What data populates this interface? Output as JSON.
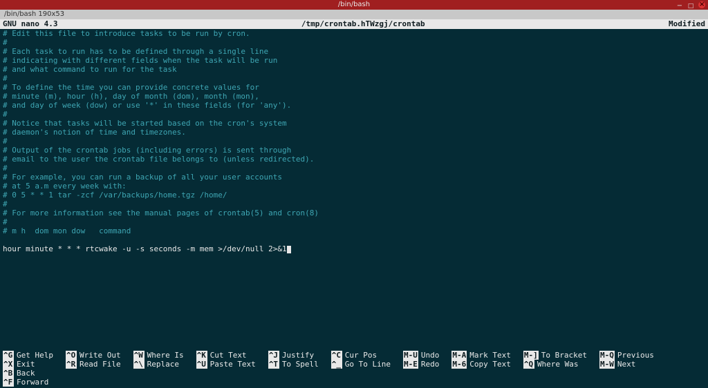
{
  "window": {
    "title": "/bin/bash"
  },
  "terminal_tab": "/bin/bash 190x53",
  "nano": {
    "version": "GNU nano 4.3",
    "file_path": "/tmp/crontab.hTWzgj/crontab",
    "status": "Modified"
  },
  "editor_lines": [
    "# Edit this file to introduce tasks to be run by cron.",
    "#",
    "# Each task to run has to be defined through a single line",
    "# indicating with different fields when the task will be run",
    "# and what command to run for the task",
    "#",
    "# To define the time you can provide concrete values for",
    "# minute (m), hour (h), day of month (dom), month (mon),",
    "# and day of week (dow) or use '*' in these fields (for 'any').",
    "#",
    "# Notice that tasks will be started based on the cron's system",
    "# daemon's notion of time and timezones.",
    "#",
    "# Output of the crontab jobs (including errors) is sent through",
    "# email to the user the crontab file belongs to (unless redirected).",
    "#",
    "# For example, you can run a backup of all your user accounts",
    "# at 5 a.m every week with:",
    "# 0 5 * * 1 tar -zcf /var/backups/home.tgz /home/",
    "#",
    "# For more information see the manual pages of crontab(5) and cron(8)",
    "#",
    "# m h  dom mon dow   command",
    ""
  ],
  "command_line": "hour minute * * * rtcwake -u -s seconds -m mem >/dev/null 2>&1",
  "shortcuts": [
    [
      {
        "key": "^G",
        "label": "Get Help"
      },
      {
        "key": "^X",
        "label": "Exit"
      }
    ],
    [
      {
        "key": "^O",
        "label": "Write Out"
      },
      {
        "key": "^R",
        "label": "Read File"
      }
    ],
    [
      {
        "key": "^W",
        "label": "Where Is"
      },
      {
        "key": "^\\",
        "label": "Replace"
      }
    ],
    [
      {
        "key": "^K",
        "label": "Cut Text"
      },
      {
        "key": "^U",
        "label": "Paste Text"
      }
    ],
    [
      {
        "key": "^J",
        "label": "Justify"
      },
      {
        "key": "^T",
        "label": "To Spell"
      }
    ],
    [
      {
        "key": "^C",
        "label": "Cur Pos"
      },
      {
        "key": "^_",
        "label": "Go To Line"
      }
    ],
    [
      {
        "key": "M-U",
        "label": "Undo"
      },
      {
        "key": "M-E",
        "label": "Redo"
      }
    ],
    [
      {
        "key": "M-A",
        "label": "Mark Text"
      },
      {
        "key": "M-6",
        "label": "Copy Text"
      }
    ],
    [
      {
        "key": "M-]",
        "label": "To Bracket"
      },
      {
        "key": "^Q",
        "label": "Where Was"
      }
    ],
    [
      {
        "key": "M-Q",
        "label": "Previous"
      },
      {
        "key": "M-W",
        "label": "Next"
      }
    ],
    [
      {
        "key": "^B",
        "label": "Back"
      },
      {
        "key": "^F",
        "label": "Forward"
      }
    ]
  ]
}
